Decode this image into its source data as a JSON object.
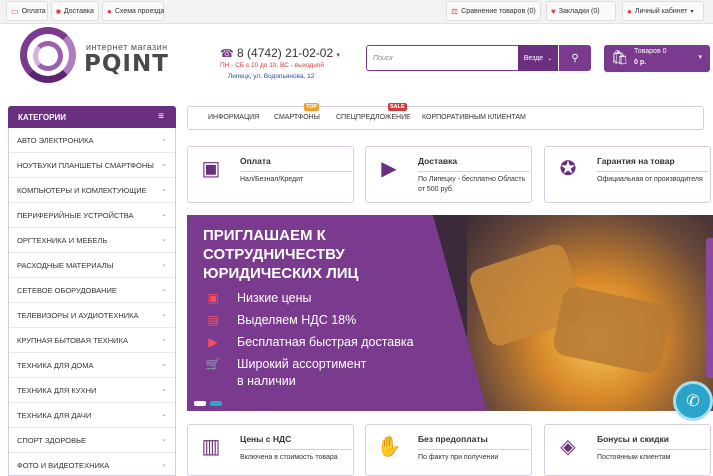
{
  "topbar": {
    "left": [
      {
        "icon": "card-icon",
        "label": "Оплата"
      },
      {
        "icon": "truck-icon",
        "label": "Доставка"
      },
      {
        "icon": "globe-icon",
        "label": "Схема проезда"
      }
    ],
    "compare_label": "Сравнение товаров (0)",
    "bookmarks_label": "Закладки (0)",
    "account_label": "Личный кабинет"
  },
  "header": {
    "logo_sub": "интернет магазин",
    "logo_text": "PQINT",
    "phone": "8 (4742) 21-02-02",
    "hours": "ПН - СБ с 10 до 19, ВС - выходной",
    "address": "Липецк, ул. Водопьянова, 12",
    "search_placeholder": "Поиск",
    "search_scope": "Везде",
    "cart_count": "Товаров 0",
    "cart_sum": "0 р."
  },
  "categories": {
    "title": "КАТЕГОРИИ",
    "items": [
      "АВТО ЭЛЕКТРОНИКА",
      "НОУТБУКИ ПЛАНШЕТЫ СМАРТФОНЫ",
      "КОМПЬЮТЕРЫ И КОМЛЕКТУЮЩИЕ",
      "ПЕРИФЕРИЙНЫЕ УСТРОЙСТВА",
      "ОРГТЕХНИКА И МЕБЕЛЬ",
      "РАСХОДНЫЕ МАТЕРИАЛЫ",
      "СЕТЕВОЕ ОБОРУДОВАНИЕ",
      "ТЕЛЕВИЗОРЫ И АУДИОТЕХНИКА",
      "КРУПНАЯ БЫТОВАЯ ТЕХНИКА",
      "ТЕХНИКА ДЛЯ ДОМА",
      "ТЕХНИКА ДЛЯ КУХНИ",
      "ТЕХНИКА ДЛЯ ДАЧИ",
      "СПОРТ ЗДОРОВЬЕ",
      "ФОТО И ВИДЕОТЕХНИКА"
    ]
  },
  "nav": {
    "items": [
      "ИНФОРМАЦИЯ",
      "СМАРТФОНЫ",
      "СПЕЦПРЕДЛОЖЕНИЕ",
      "КОРПОРАТИВНЫМ КЛИЕНТАМ"
    ],
    "badge_top": "TOP",
    "badge_sale": "SALE"
  },
  "features_top": [
    {
      "icon": "wallet-icon",
      "title": "Оплата",
      "text": "Нал/Безнал/Кредит"
    },
    {
      "icon": "delivery-truck-icon",
      "title": "Доставка",
      "text": "По Липецку - бесплатно Область от 500 руб."
    },
    {
      "icon": "certificate-icon",
      "title": "Гарантия на товар",
      "text": "Официальная от производителя"
    }
  ],
  "features_bottom": [
    {
      "icon": "receipt-icon",
      "title": "Цены с НДС",
      "text": "Включена в стоимость товара"
    },
    {
      "icon": "hand-card-icon",
      "title": "Без предоплаты",
      "text": "По факту при получении"
    },
    {
      "icon": "tag-icon",
      "title": "Бонусы и скидки",
      "text": "Постоянным клиентам"
    }
  ],
  "banner": {
    "headline": "ПРИГЛАШАЕМ К СОТРУДНИЧЕСТВУ ЮРИДИЧЕСКИХ ЛИЦ",
    "items": [
      {
        "icon": "wallet-icon",
        "text": "Низкие цены"
      },
      {
        "icon": "document-icon",
        "text": "Выделяем НДС 18%"
      },
      {
        "icon": "truck-icon",
        "text": "Бесплатная быстрая доставка"
      },
      {
        "icon": "cart-icon",
        "text": "Широкий ассортимент"
      },
      {
        "icon": "",
        "text": "в наличии"
      }
    ]
  },
  "colors": {
    "brand": "#7a3b8e",
    "brand_dark": "#6b2f80",
    "accent_red": "#d23c3c",
    "call_button": "#2aa4c9"
  }
}
